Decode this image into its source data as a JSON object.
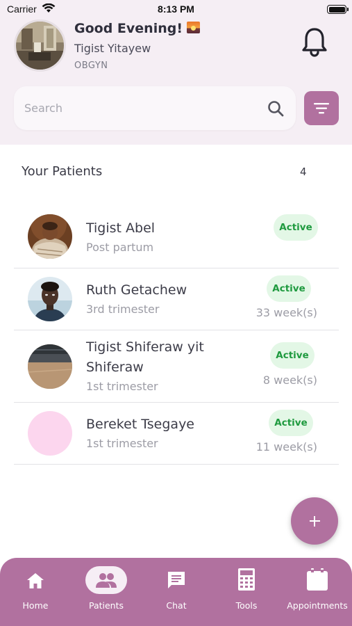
{
  "status_bar": {
    "carrier": "Carrier",
    "time": "8:13 PM"
  },
  "header": {
    "greeting": "Good Evening!",
    "greeting_icon": "sunset-emoji",
    "user_name": "Tigist Yitayew",
    "user_role": "OBGYN"
  },
  "search": {
    "placeholder": "Search"
  },
  "patients": {
    "title": "Your Patients",
    "count": "4",
    "items": [
      {
        "name": "Tigist Abel",
        "stage": "Post partum",
        "status": "Active",
        "weeks": ""
      },
      {
        "name": "Ruth Getachew",
        "stage": "3rd trimester",
        "status": "Active",
        "weeks": "33 week(s)"
      },
      {
        "name": "Tigist Shiferaw yit Shiferaw",
        "stage": "1st trimester",
        "status": "Active",
        "weeks": "8 week(s)"
      },
      {
        "name": "Bereket Tsegaye",
        "stage": "1st trimester",
        "status": "Active",
        "weeks": "11 week(s)"
      }
    ]
  },
  "nav": {
    "items": [
      {
        "label": "Home",
        "icon": "home-icon"
      },
      {
        "label": "Patients",
        "icon": "people-icon",
        "selected": true
      },
      {
        "label": "Chat",
        "icon": "chat-icon"
      },
      {
        "label": "Tools",
        "icon": "calculator-icon"
      },
      {
        "label": "Appointments",
        "icon": "calendar-icon"
      }
    ]
  },
  "colors": {
    "accent": "#b1719f",
    "header_bg": "#f5eef4",
    "badge_bg": "#e3f7e6",
    "badge_text": "#1f9a3f"
  }
}
